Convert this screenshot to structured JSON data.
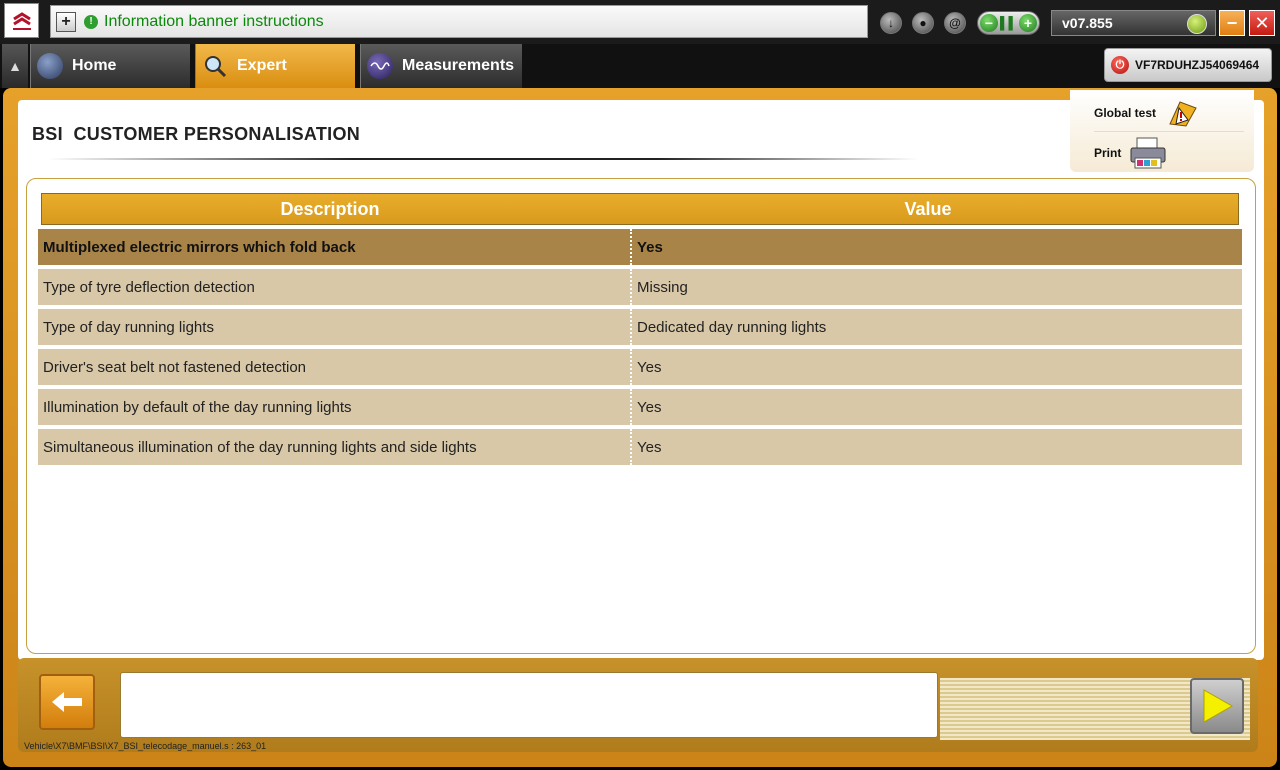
{
  "topbar": {
    "logo": "citroen-logo",
    "info_banner": "Information banner instructions",
    "version": "v07.855",
    "vin": "VF7RDUHZJ54069464",
    "colors": {
      "banner_text": "#0a8a0a",
      "accent": "#e6a12a"
    }
  },
  "tabs": [
    {
      "label": "Home",
      "icon": "home-dial-icon",
      "active": false
    },
    {
      "label": "Expert",
      "icon": "magnifier-icon",
      "active": true
    },
    {
      "label": "Measurements",
      "icon": "waveform-icon",
      "active": false
    }
  ],
  "page": {
    "title": "BSI  CUSTOMER PERSONALISATION",
    "tools": {
      "global_test": "Global test",
      "print": "Print"
    }
  },
  "table": {
    "headers": {
      "description": "Description",
      "value": "Value"
    },
    "rows": [
      {
        "description": "Multiplexed electric mirrors which fold back",
        "value": "Yes"
      },
      {
        "description": "Type of tyre deflection detection",
        "value": "Missing"
      },
      {
        "description": "Type of day running lights",
        "value": "Dedicated day running lights"
      },
      {
        "description": "Driver's seat belt not fastened detection",
        "value": "Yes"
      },
      {
        "description": "Illumination by default of the day running lights",
        "value": "Yes"
      },
      {
        "description": "Simultaneous illumination of the day running lights and side lights",
        "value": "Yes"
      }
    ]
  },
  "footer": {
    "message": "",
    "path": "Vehicle\\X7\\BMF\\BSI\\X7_BSI_telecodage_manuel.s : 263_01"
  }
}
